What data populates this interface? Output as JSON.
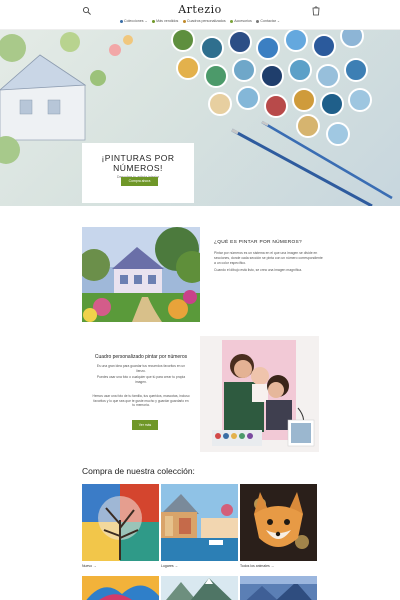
{
  "header": {
    "logo": "Artezio",
    "nav": [
      {
        "label": "Colecciones",
        "caret": "⌄",
        "color": "#3a6ea5"
      },
      {
        "label": "Más vendidos",
        "caret": "",
        "color": "#6f9728"
      },
      {
        "label": "Cuadros personalizados",
        "caret": "",
        "color": "#c08a2a"
      },
      {
        "label": "Accesorios",
        "caret": "",
        "color": "#7aa33a"
      },
      {
        "label": "Contactar",
        "caret": "⌄",
        "color": "#555555"
      }
    ]
  },
  "hero": {
    "title": "¡PINTURAS POR NÚMEROS!",
    "subtitle": "Descubre tu artista interior",
    "button": "Compra ahora"
  },
  "que_es": {
    "title": "¿QUÉ ES PINTAR POR NÚMEROS?",
    "p1": "Pintar por números es un sistema en el que una imagen se divide en secciones, donde cada sección se pinta con un número correspondiente a un color específico.",
    "p2": "Cuando el dibujo está listo, se crea una imagen magnífica."
  },
  "cuadro": {
    "title": "Cuadro personalizado pintar por números",
    "p1": "Es una gran idea para guardar tus recuerdos favoritos en un lienzo.",
    "p2": "Puedes usar una foto o cualquier que tú para crear tu propia imagen.",
    "p3": "Hemos usar una foto de tu familia, tus queridos, mascotas, incluso favoritos y lo que sea que te guste mucho y guardar guardarlo en tu memoria.",
    "button": "Ver más"
  },
  "collection": {
    "title": "Compra de nuestra colección:",
    "cards": [
      {
        "label": "Nuevo",
        "arrow": "→"
      },
      {
        "label": "Lugares",
        "arrow": "→"
      },
      {
        "label": "Todos los animales",
        "arrow": "→"
      }
    ]
  },
  "colors": {
    "accent": "#6f9728",
    "text": "#222222"
  }
}
